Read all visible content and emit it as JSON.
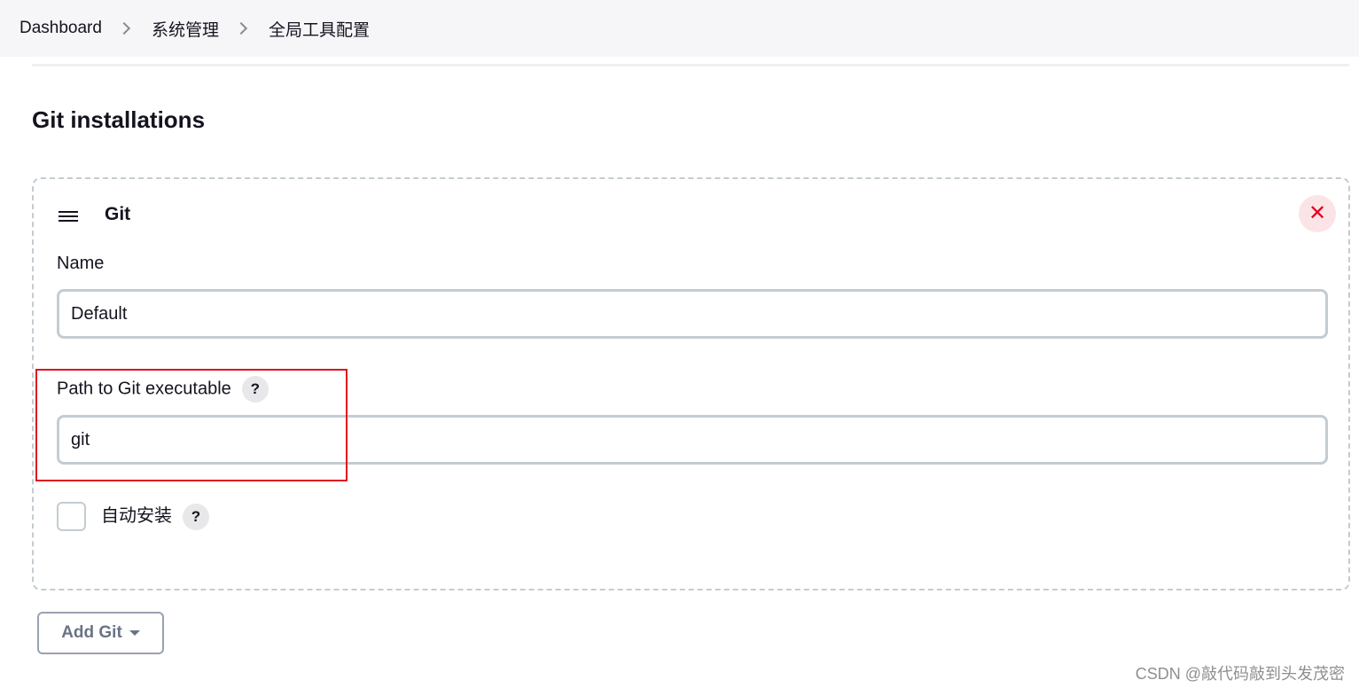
{
  "breadcrumb": {
    "items": [
      "Dashboard",
      "系统管理",
      "全局工具配置"
    ]
  },
  "section": {
    "title": "Git installations"
  },
  "installation": {
    "title": "Git",
    "delete_icon": "close-icon",
    "name_label": "Name",
    "name_value": "Default",
    "path_label": "Path to Git executable",
    "path_value": "git",
    "help_text": "?",
    "auto_install_label": "自动安装",
    "auto_install_checked": false
  },
  "add_button": {
    "label": "Add Git"
  },
  "watermark": "CSDN @敲代码敲到头发茂密",
  "colors": {
    "delete_accent": "#e6001f",
    "highlight_box": "#e0141e",
    "breadcrumb_bg": "#f6f6f8"
  }
}
